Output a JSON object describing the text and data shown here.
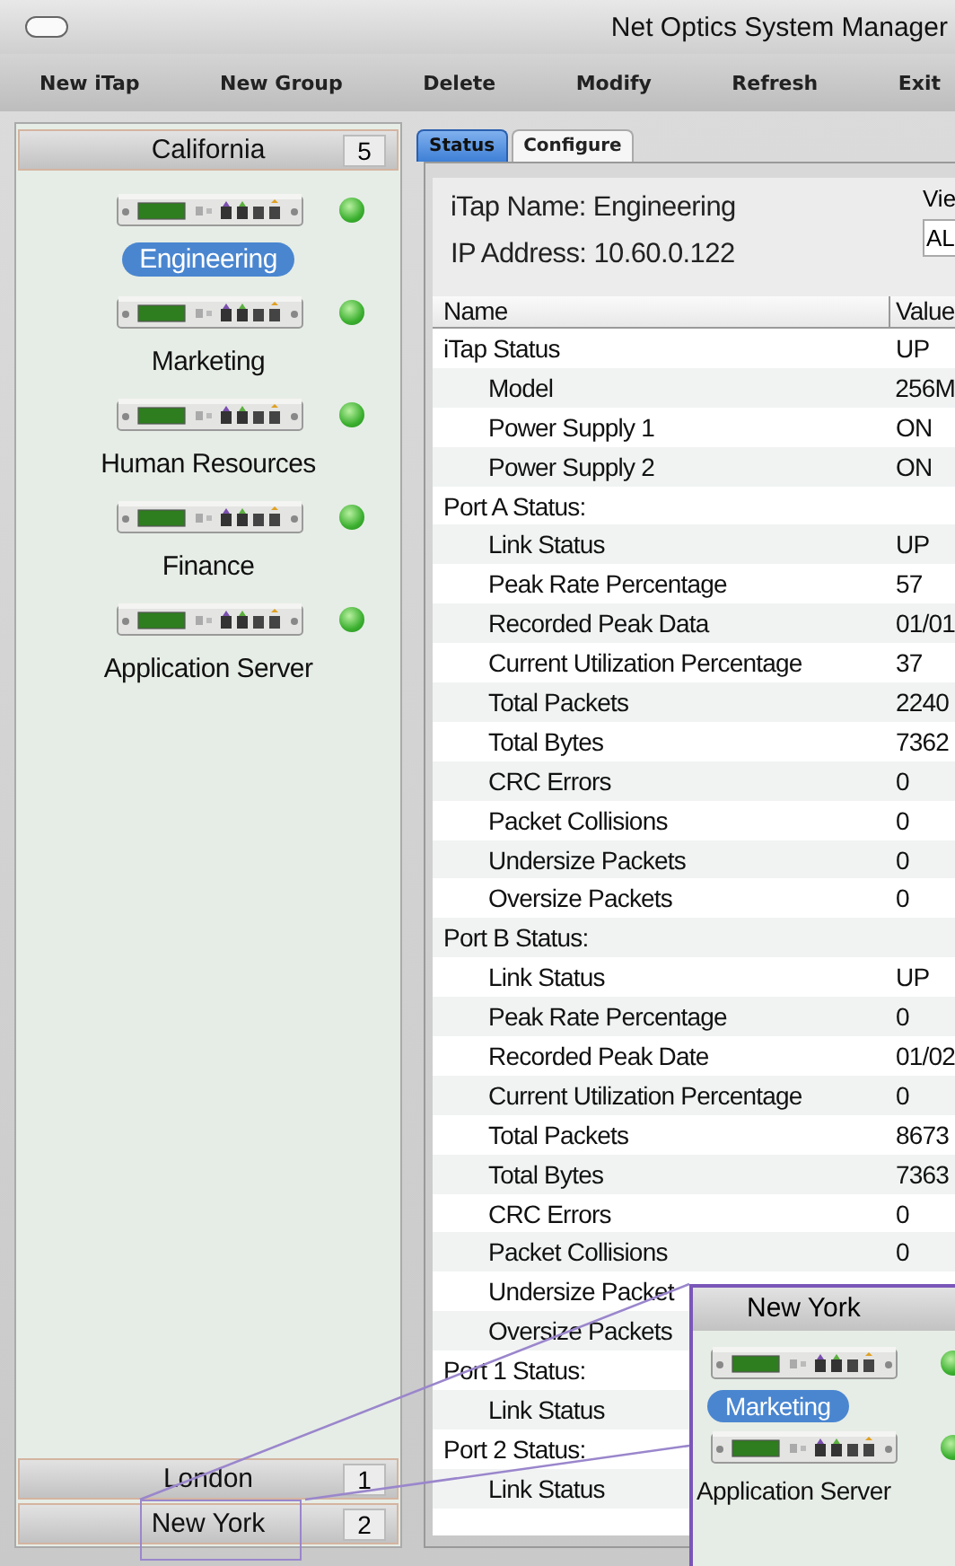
{
  "window": {
    "title": "Net Optics System Manager"
  },
  "toolbar": [
    "New iTap",
    "New Group",
    "Delete",
    "Modify",
    "Refresh",
    "Exit"
  ],
  "sidebar": {
    "groups": [
      {
        "name": "California",
        "count": "5",
        "expanded": true,
        "magnified": false,
        "devices": [
          {
            "name": "Engineering",
            "selected": true
          },
          {
            "name": "Marketing",
            "selected": false
          },
          {
            "name": "Human Resources",
            "selected": false
          },
          {
            "name": "Finance",
            "selected": false
          },
          {
            "name": "Application Server",
            "selected": false
          }
        ]
      },
      {
        "name": "London",
        "count": "1",
        "expanded": false,
        "magnified": false
      },
      {
        "name": "New York",
        "count": "2",
        "expanded": false,
        "magnified": true
      }
    ]
  },
  "tabs": [
    {
      "label": "Status",
      "selected": true
    },
    {
      "label": "Configure",
      "selected": false
    }
  ],
  "info": {
    "name": "iTap Name: Engineering",
    "ip": "IP Address: 10.60.0.122",
    "view_label": "Vie",
    "view_value": "AL"
  },
  "table": {
    "columns": [
      "Name",
      "Value"
    ],
    "rows": [
      {
        "name": "iTap Status",
        "value": "UP",
        "children": [
          {
            "name": "Model",
            "value": "256M"
          },
          {
            "name": "Power Supply 1",
            "value": "ON"
          },
          {
            "name": "Power Supply 2",
            "value": "ON"
          }
        ]
      },
      {
        "name": "Port A Status:",
        "children": [
          {
            "name": "Link Status",
            "value": "UP"
          },
          {
            "name": "Peak Rate Percentage",
            "value": "57"
          },
          {
            "name": "Recorded Peak Data",
            "value": "01/01"
          },
          {
            "name": "Current Utilization Percentage",
            "value": "37"
          },
          {
            "name": "Total Packets",
            "value": "2240"
          },
          {
            "name": "Total Bytes",
            "value": "7362"
          },
          {
            "name": "CRC Errors",
            "value": "0"
          },
          {
            "name": "Packet Collisions",
            "value": "0"
          },
          {
            "name": "Undersize Packets",
            "value": "0"
          },
          {
            "name": "Oversize Packets",
            "value": "0"
          }
        ]
      },
      {
        "name": "Port B Status:",
        "children": [
          {
            "name": "Link Status",
            "value": "UP"
          },
          {
            "name": "Peak Rate Percentage",
            "value": "0"
          },
          {
            "name": "Recorded Peak Date",
            "value": "01/02"
          },
          {
            "name": "Current Utilization Percentage",
            "value": "0"
          },
          {
            "name": "Total Packets",
            "value": "8673"
          },
          {
            "name": "Total Bytes",
            "value": "7363"
          },
          {
            "name": "CRC Errors",
            "value": "0"
          },
          {
            "name": "Packet Collisions",
            "value": "0"
          },
          {
            "name": "Undersize Packet"
          },
          {
            "name": "Oversize Packets"
          }
        ]
      },
      {
        "name": "Port 1 Status:",
        "children": [
          {
            "name": "Link Status"
          }
        ]
      },
      {
        "name": "Port 2 Status:",
        "children": [
          {
            "name": "Link Status"
          }
        ]
      }
    ]
  },
  "callout": {
    "group": "New York",
    "devices": [
      {
        "name": "Marketing",
        "selected": true
      },
      {
        "name": "Application Server",
        "selected": false
      }
    ]
  }
}
